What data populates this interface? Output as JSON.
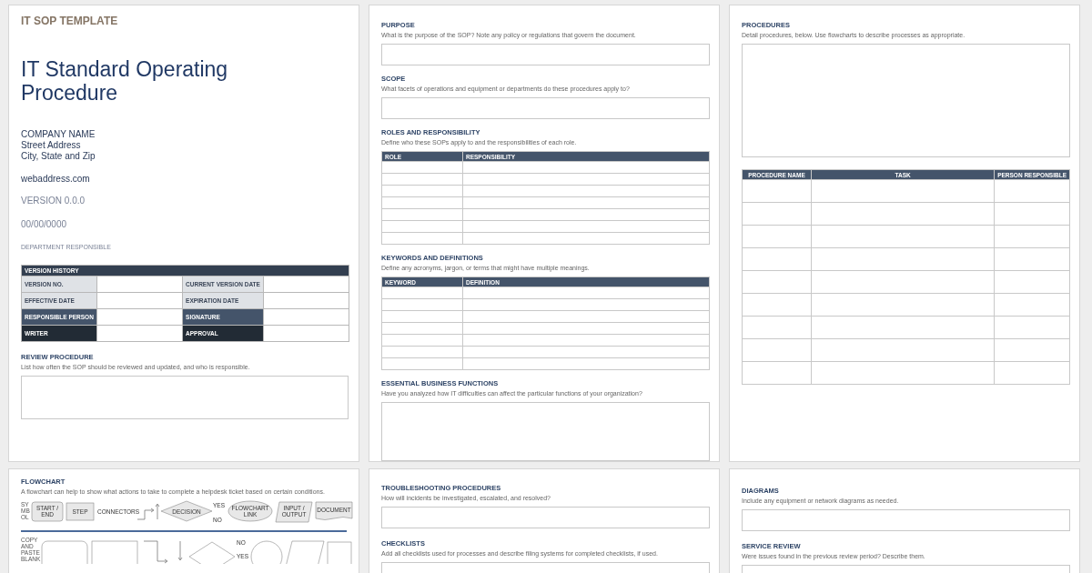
{
  "cover": {
    "template_label": "IT SOP TEMPLATE",
    "title": "IT Standard Operating Procedure",
    "company_lines": [
      "COMPANY NAME",
      "Street Address",
      "City, State and Zip"
    ],
    "website": "webaddress.com",
    "version": "VERSION 0.0.0",
    "date": "00/00/0000",
    "department": "DEPARTMENT RESPONSIBLE"
  },
  "version_history": {
    "title": "VERSION HISTORY",
    "rows": [
      {
        "cells": [
          {
            "label": "VERSION NO.",
            "kind": "light"
          },
          {
            "label": "CURRENT VERSION DATE",
            "kind": "light"
          }
        ]
      },
      {
        "cells": [
          {
            "label": "EFFECTIVE DATE",
            "kind": "light"
          },
          {
            "label": "EXPIRATION DATE",
            "kind": "light"
          }
        ]
      },
      {
        "cells": [
          {
            "label": "RESPONSIBLE PERSON",
            "kind": "medium"
          },
          {
            "label": "SIGNATURE",
            "kind": "medium"
          }
        ]
      },
      {
        "cells": [
          {
            "label": "WRITER",
            "kind": "dark"
          },
          {
            "label": "APPROVAL",
            "kind": "dark"
          }
        ]
      }
    ]
  },
  "review": {
    "heading": "REVIEW PROCEDURE",
    "hint": "List how often the SOP should be reviewed and updated, and who is responsible."
  },
  "page_2": {
    "sections": [
      {
        "kind": "box",
        "heading": "PURPOSE",
        "hint": "What is the purpose of the SOP? Note any policy or regulations that govern the document."
      },
      {
        "kind": "box",
        "heading": "SCOPE",
        "hint": "What facets of operations and equipment or departments do these procedures apply to?"
      },
      {
        "kind": "table",
        "heading": "ROLES AND RESPONSIBILITY",
        "hint": "Define who these SOPs apply to and the responsibilities of each role.",
        "columns": [
          "ROLE",
          "RESPONSIBILITY"
        ]
      },
      {
        "kind": "table",
        "heading": "KEYWORDS AND DEFINITIONS",
        "hint": "Define any acronyms, jargon, or terms that might have multiple meanings.",
        "columns": [
          "KEYWORD",
          "DEFINITION"
        ]
      },
      {
        "kind": "box",
        "heading": "ESSENTIAL BUSINESS FUNCTIONS",
        "hint": "Have you analyzed how IT difficulties can affect the particular functions of your organization?"
      }
    ]
  },
  "page_3": {
    "heading": "PROCEDURES",
    "hint": "Detail procedures, below.  Use flowcharts to describe processes as appropriate.",
    "columns": [
      "PROCEDURE NAME",
      "TASK",
      "PERSON RESPONSIBLE"
    ]
  },
  "flowchart": {
    "heading": "FLOWCHART",
    "hint": "A flowchart can help to show what actions to take to complete a helpdesk ticket based on certain conditions.",
    "side_label": "SY MB OL",
    "legend": [
      {
        "kind": "terminal",
        "label": "START / END"
      },
      {
        "kind": "process",
        "label": "STEP"
      },
      {
        "kind": "connector",
        "label": "CONNECTORS"
      },
      {
        "kind": "decision",
        "label": "DECISION"
      },
      {
        "kind": "link",
        "label": "FLOWCHART LINK"
      },
      {
        "kind": "io",
        "label": "INPUT / OUTPUT"
      },
      {
        "kind": "document",
        "label": "DOCUMENT"
      }
    ],
    "yes_label": "YES",
    "no_label": "NO",
    "blank_label": "COPY AND PASTE BLANK",
    "blank_no_label": "NO",
    "blank_yes_label": "YES"
  },
  "page_5": {
    "sections": [
      {
        "heading": "TROUBLESHOOTING PROCEDURES",
        "hint": "How will incidents be investigated, escalated, and resolved?"
      },
      {
        "heading": "CHECKLISTS",
        "hint": "Add all checklists used for processes and describe filing systems for completed checklists, if used."
      }
    ]
  },
  "page_6": {
    "sections": [
      {
        "heading": "DIAGRAMS",
        "hint": "Include any equipment or network diagrams as needed."
      },
      {
        "heading": "SERVICE REVIEW",
        "hint": "Were issues found in the previous review period? Describe them."
      }
    ]
  }
}
